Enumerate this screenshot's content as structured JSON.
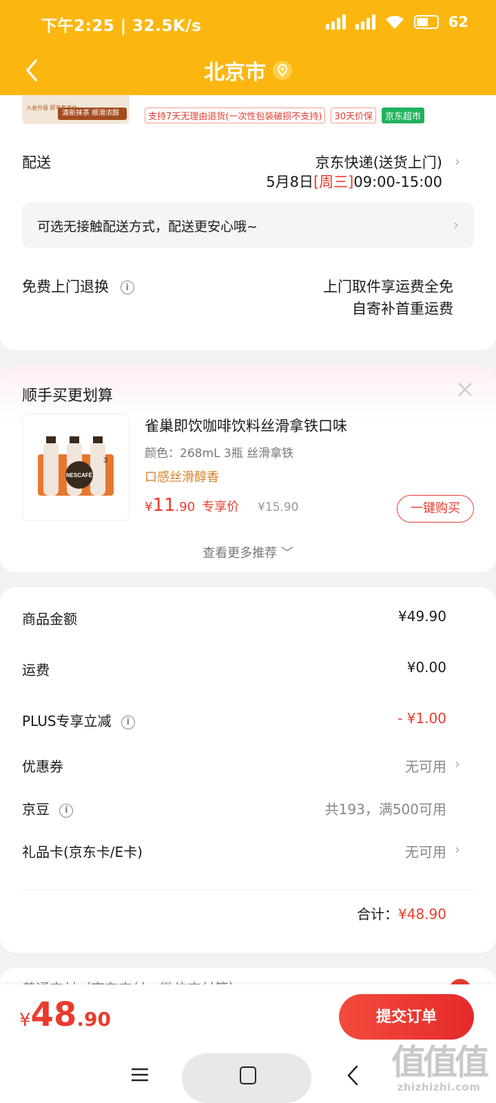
{
  "status_bar": {
    "time": "下午2:25 | 32.5K/s",
    "battery": "62",
    "battery_level": 0.62
  },
  "nav": {
    "title": "北京市"
  },
  "top_product": {
    "thumb_left": "入会升级 即享专享价",
    "thumb_right": "清新抹茶 顺滑浓醇"
  },
  "service_tags": [
    "支持7天无理由退货(一次性包装破损不支持)",
    "30天价保",
    "京东超市"
  ],
  "delivery": {
    "label": "配送",
    "method": "京东快递(送货上门)",
    "date": "5月8日",
    "weekday": "[周三]",
    "time_window": "09:00-15:00",
    "contactless": "可选无接触配送方式，配送更安心哦~"
  },
  "free_return": {
    "label": "免费上门退换",
    "line1": "上门取件享运费全免",
    "line2": "自寄补首重运费"
  },
  "recommend": {
    "title": "顺手买更划算",
    "product_name": "雀巢即饮咖啡饮料丝滑拿铁口味",
    "spec": "颜色：268mL 3瓶  丝滑拿铁",
    "feature": "口感丝滑醇香",
    "price_symbol": "¥",
    "price_int": "11",
    "price_dec": ".90",
    "exclusive_label": "专享价",
    "original_price": "¥15.90",
    "buy_button": "一键购买",
    "more": "查看更多推荐 ﹀",
    "thumb_brand": "NESCAFÉ",
    "thumb_count": "3"
  },
  "fees": [
    {
      "label": "商品金额",
      "value": "¥49.90"
    },
    {
      "label": "运费",
      "value": "¥0.00"
    },
    {
      "label": "PLUS专享立减",
      "value": "- ¥1.00"
    },
    {
      "label": "优惠券",
      "value": "无可用"
    },
    {
      "label": "京豆",
      "value": "共193，满500可用"
    },
    {
      "label": "礼品卡(京东卡/E卡)",
      "value": "无可用"
    }
  ],
  "total": {
    "label": "合计：",
    "amount": "¥48.90"
  },
  "payment_partial": "普通支付（京东支付、微信支付等）",
  "bottom": {
    "currency": "¥",
    "int": "48",
    "dec": ".90",
    "submit": "提交订单"
  },
  "watermark": {
    "big": "值值值",
    "small": "zhizhizhi.com"
  },
  "colors": {
    "brand_yellow": "#fbb710",
    "price_red": "#e93b2e",
    "tag_green": "#20b25c"
  }
}
